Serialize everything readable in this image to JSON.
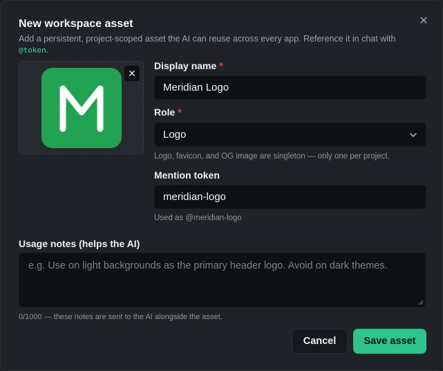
{
  "dialog": {
    "title": "New workspace asset",
    "subtitle_text": "Add a persistent, project-scoped asset the AI can reuse across every app. Reference it in chat with",
    "subtitle_code": "@token",
    "subtitle_end": ".",
    "close_icon": "close-icon"
  },
  "image": {
    "letter": "M",
    "tile_color": "#23a253",
    "remove_icon": "close-icon"
  },
  "fields": {
    "display_name": {
      "label": "Display name",
      "required": "*",
      "value": "Meridian Logo"
    },
    "role": {
      "label": "Role",
      "required": "*",
      "value": "Logo",
      "hint": "Logo, favicon, and OG image are singleton — only one per project."
    },
    "mention_token": {
      "label": "Mention token",
      "value": "meridian-logo",
      "hint": "Used as @meridian-logo"
    },
    "usage_notes": {
      "label": "Usage notes (helps the AI)",
      "placeholder": "e.g. Use on light backgrounds as the primary header logo. Avoid on dark themes.",
      "hint": "0/1000 — these notes are sent to the AI alongside the asset."
    }
  },
  "actions": {
    "cancel_label": "Cancel",
    "save_label": "Save asset",
    "accent": "#2fc38e"
  }
}
